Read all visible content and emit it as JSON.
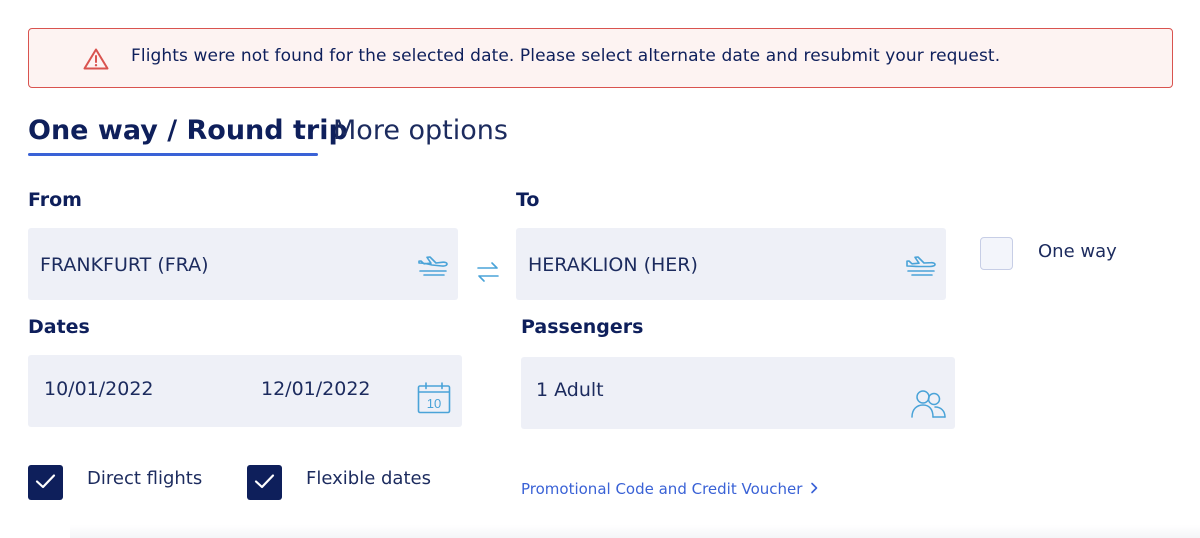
{
  "alert": {
    "icon": "warning-triangle-icon",
    "message": "Flights were not found for the selected date. Please select alternate date and resubmit your request.",
    "border_color": "#d9534f"
  },
  "tabs": [
    {
      "label": "One way / Round trip",
      "active": true
    },
    {
      "label": "More options",
      "active": false
    }
  ],
  "search": {
    "from_label": "From",
    "from_value": "FRANKFURT (FRA)",
    "to_label": "To",
    "to_value": "HERAKLION (HER)",
    "one_way_label": "One way",
    "one_way_checked": false,
    "dates_label": "Dates",
    "depart_date": "10/01/2022",
    "return_date": "12/01/2022",
    "calendar_day": "10",
    "passengers_label": "Passengers",
    "passengers_value": "1 Adult",
    "direct_flights_label": "Direct flights",
    "direct_flights_checked": true,
    "flexible_dates_label": "Flexible dates",
    "flexible_dates_checked": true,
    "promo_link": "Promotional Code and Credit Voucher"
  },
  "colors": {
    "navy": "#0e1f5b",
    "accent_blue": "#3a62d6",
    "icon_blue": "#4aa3d8",
    "field_bg": "#eef0f7",
    "alert_red": "#d9534f"
  }
}
